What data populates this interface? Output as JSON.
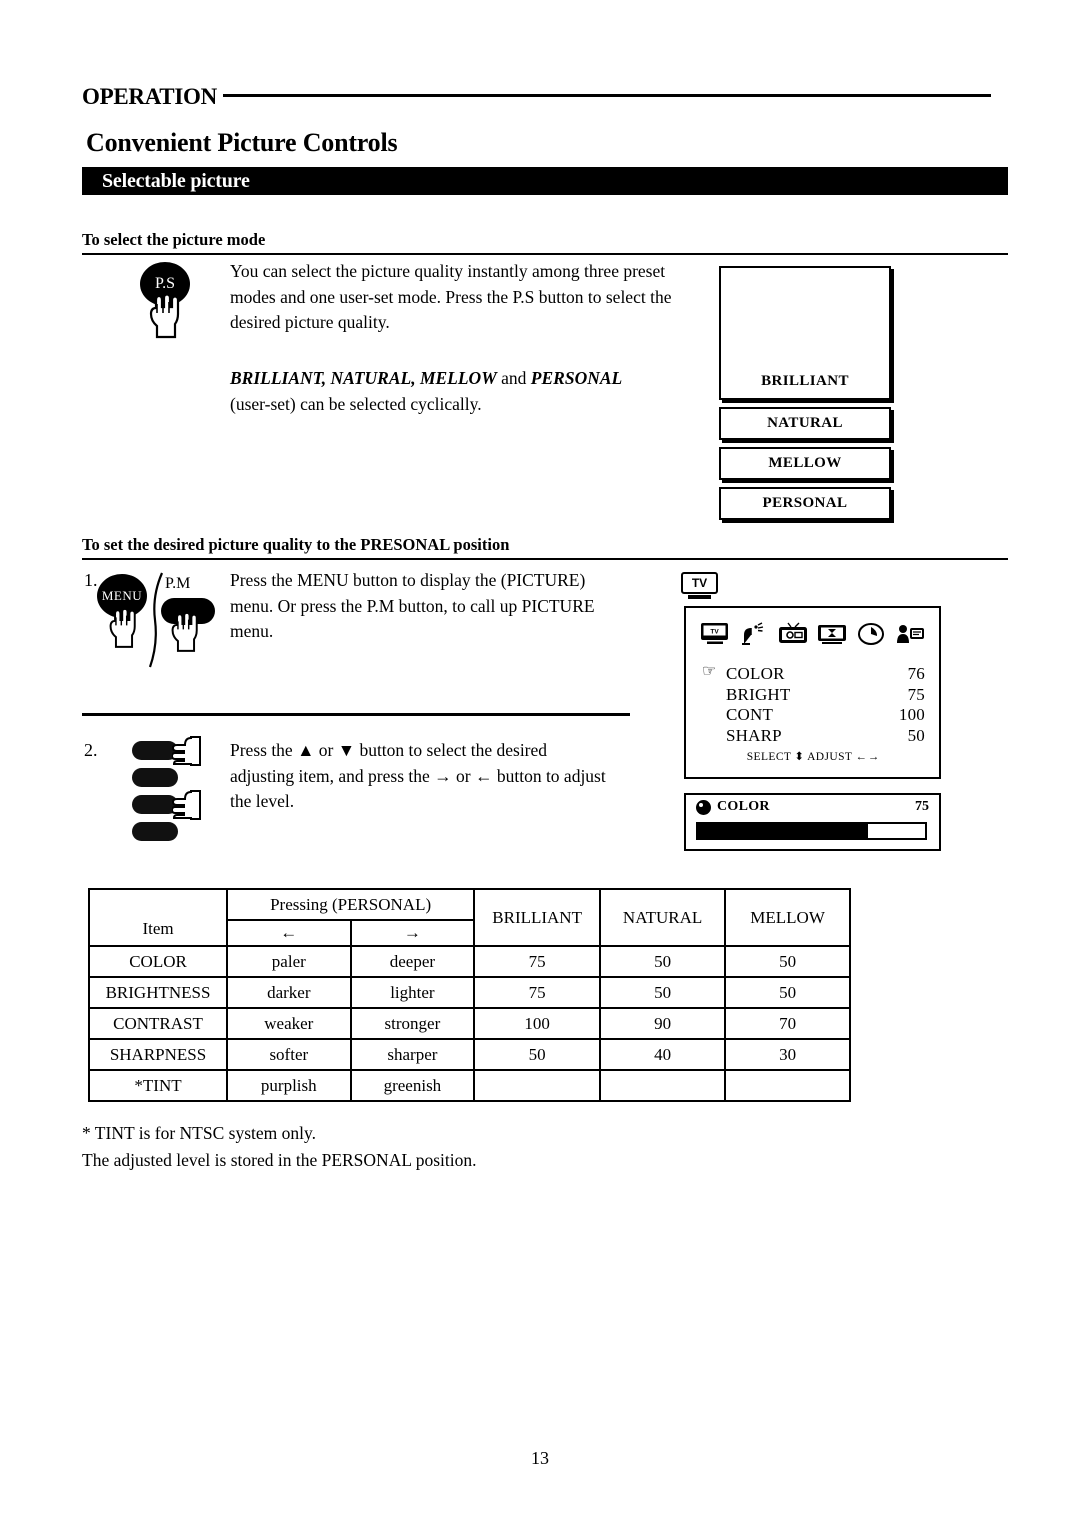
{
  "header": {
    "operation_label": "OPERATION",
    "page_title": "Convenient Picture Controls",
    "section_bar_label": "Selectable picture"
  },
  "section_select_mode": {
    "heading": "To select the picture mode",
    "paragraph_1": "You can select the picture quality instantly among three preset modes and one user-set mode. Press the P.S button to select the desired picture quality.",
    "paragraph_2_bold": "BRILLIANT, NATURAL, MELLOW",
    "paragraph_2_and": " and ",
    "paragraph_2_bold2": "PERSONAL",
    "paragraph_3": "(user-set) can be selected cyclically.",
    "ps_button_label": "P.S",
    "mode_boxes": [
      "BRILLIANT",
      "NATURAL",
      "MELLOW",
      "PERSONAL"
    ]
  },
  "section_personal": {
    "heading": "To set the desired picture quality to the PRESONAL position",
    "step_1_number": "1.",
    "step_1_text": "Press the MENU button to display the (PICTURE) menu. Or press the P.M button, to call up PICTURE menu.",
    "menu_button_label": "MENU",
    "pm_button_label": "P.M",
    "step_2_number": "2.",
    "step_2_text_a": "Press the ",
    "step_2_up": "▲",
    "step_2_text_b": " or ",
    "step_2_down": "▼",
    "step_2_text_c": " button to select the desired adjusting item, and press the ",
    "step_2_right": "→",
    "step_2_text_d": " or ",
    "step_2_left": "←",
    "step_2_text_e": " button to adjust the level."
  },
  "osd": {
    "tv_badge": "TV",
    "icons": [
      "tv-icon",
      "satellite-dish-icon",
      "picture-icon",
      "hourglass-icon",
      "clock-icon",
      "teletext-icon"
    ],
    "items": [
      {
        "name": "COLOR",
        "value": "76",
        "selected": true
      },
      {
        "name": "BRIGHT",
        "value": "75",
        "selected": false
      },
      {
        "name": "CONT",
        "value": "100",
        "selected": false
      },
      {
        "name": "SHARP",
        "value": "50",
        "selected": false
      }
    ],
    "footer_select": "SELECT",
    "footer_select_arrows": "⬍",
    "footer_adjust": "ADJUST",
    "footer_adjust_arrows": "← →",
    "slider": {
      "label": "COLOR",
      "value": "75",
      "fill_percent": 75
    }
  },
  "table": {
    "header_item": "Item",
    "header_pressing": "Pressing (PERSONAL)",
    "header_arrow_left": "←",
    "header_arrow_right": "→",
    "header_modes": [
      "BRILLIANT",
      "NATURAL",
      "MELLOW"
    ],
    "rows": [
      {
        "item": "COLOR",
        "left": "paler",
        "right": "deeper",
        "brilliant": "75",
        "natural": "50",
        "mellow": "50"
      },
      {
        "item": "BRIGHTNESS",
        "left": "darker",
        "right": "lighter",
        "brilliant": "75",
        "natural": "50",
        "mellow": "50"
      },
      {
        "item": "CONTRAST",
        "left": "weaker",
        "right": "stronger",
        "brilliant": "100",
        "natural": "90",
        "mellow": "70"
      },
      {
        "item": "SHARPNESS",
        "left": "softer",
        "right": "sharper",
        "brilliant": "50",
        "natural": "40",
        "mellow": "30"
      },
      {
        "item": "*TINT",
        "left": "purplish",
        "right": "greenish",
        "brilliant": "",
        "natural": "",
        "mellow": ""
      }
    ]
  },
  "footnotes": {
    "line_1": "* TINT is for NTSC system only.",
    "line_2": "The adjusted level is stored in the PERSONAL position."
  },
  "page_number": "13"
}
